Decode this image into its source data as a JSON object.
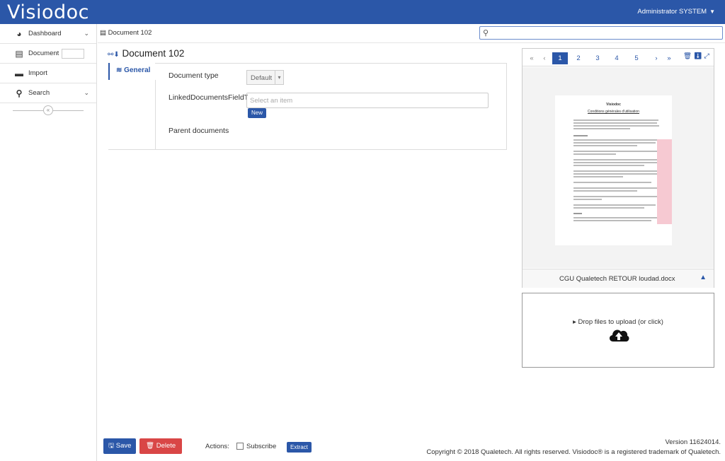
{
  "app": {
    "logo": "Visiodoc",
    "user": "Administrator SYSTEM",
    "accent": "#2b57a8",
    "danger": "#d94646"
  },
  "sidebar": {
    "items": [
      {
        "label": "Dashboard",
        "icon": "dashboard-icon"
      },
      {
        "label": "Document",
        "icon": "document-icon"
      },
      {
        "label": "Import",
        "icon": "import-icon"
      },
      {
        "label": "Search",
        "icon": "search-icon"
      }
    ],
    "collapse_icon": "double-chevron-left-icon"
  },
  "breadcrumb": "Document 102",
  "search": {
    "value": "",
    "placeholder": ""
  },
  "document": {
    "title": "Document 102"
  },
  "tabs": [
    {
      "label": "General"
    }
  ],
  "form": {
    "document_type_label": "Document type",
    "document_type_value": "Default",
    "linked_label": "LinkedDocumentsFieldTy",
    "linked_placeholder": "Select an item",
    "new_label": "New",
    "parent_label": "Parent documents"
  },
  "viewer": {
    "pager": [
      "«",
      "‹",
      "1",
      "2",
      "3",
      "4",
      "5",
      "›",
      "»"
    ],
    "active_page": "1",
    "doc_heading": "Visiodoc",
    "doc_subheading": "Conditions générales d'utilisation",
    "file_name": "CGU Qualetech RETOUR loudad.docx"
  },
  "upload": {
    "label": "Drop files to upload (or click)"
  },
  "footer": {
    "save": "Save",
    "delete": "Delete",
    "actions_label": "Actions:",
    "subscribe_label": "Subscribe",
    "extract": "Extract",
    "version": "Version 11624014.",
    "copyright": "Copyright © 2018 Qualetech. All rights reserved. Visiodoc® is a registered trademark of Qualetech."
  }
}
